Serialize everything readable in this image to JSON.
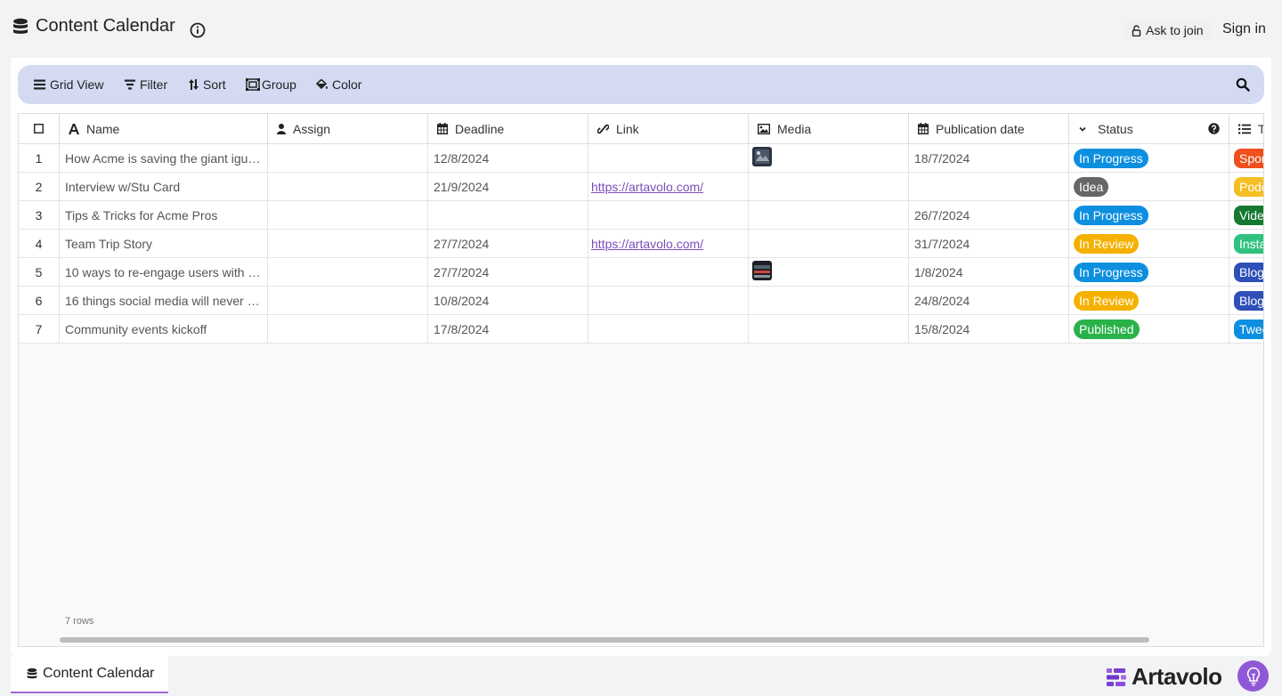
{
  "header": {
    "title": "Content Calendar",
    "ask_join": "Ask to join",
    "sign_in": "Sign in"
  },
  "toolbar": {
    "grid_view": "Grid View",
    "filter": "Filter",
    "sort": "Sort",
    "group": "Group",
    "color": "Color"
  },
  "columns": [
    {
      "label": "Name",
      "icon": "text-icon"
    },
    {
      "label": "Assign",
      "icon": "user-icon"
    },
    {
      "label": "Deadline",
      "icon": "calendar-icon"
    },
    {
      "label": "Link",
      "icon": "link-icon"
    },
    {
      "label": "Media",
      "icon": "image-icon"
    },
    {
      "label": "Publication date",
      "icon": "calendar-icon"
    },
    {
      "label": "Status",
      "icon": "chevron-down-icon"
    },
    {
      "label": "Ty",
      "icon": "list-icon"
    }
  ],
  "rows": [
    {
      "num": "1",
      "name": "How Acme is saving the giant igu…",
      "assign": "",
      "deadline": "12/8/2024",
      "link": "",
      "media": "thumb",
      "pub_date": "18/7/2024",
      "status": "In Progress",
      "type": "Spon"
    },
    {
      "num": "2",
      "name": "Interview w/Stu Card",
      "assign": "",
      "deadline": "21/9/2024",
      "link": "https://artavolo.com/",
      "media": "",
      "pub_date": "",
      "status": "Idea",
      "type": "Podc"
    },
    {
      "num": "3",
      "name": "Tips & Tricks for Acme Pros",
      "assign": "",
      "deadline": "",
      "link": "",
      "media": "",
      "pub_date": "26/7/2024",
      "status": "In Progress",
      "type": "Vide"
    },
    {
      "num": "4",
      "name": "Team Trip Story",
      "assign": "",
      "deadline": "27/7/2024",
      "link": "https://artavolo.com/",
      "media": "",
      "pub_date": "31/7/2024",
      "status": "In Review",
      "type": "Insta"
    },
    {
      "num": "5",
      "name": "10 ways to re-engage users with …",
      "assign": "",
      "deadline": "27/7/2024",
      "link": "",
      "media": "thumb",
      "pub_date": "1/8/2024",
      "status": "In Progress",
      "type": "Blog"
    },
    {
      "num": "6",
      "name": "16 things social media will never …",
      "assign": "",
      "deadline": "10/8/2024",
      "link": "",
      "media": "",
      "pub_date": "24/8/2024",
      "status": "In Review",
      "type": "Blog"
    },
    {
      "num": "7",
      "name": "Community events kickoff",
      "assign": "",
      "deadline": "17/8/2024",
      "link": "",
      "media": "",
      "pub_date": "15/8/2024",
      "status": "Published",
      "type": "Twee"
    }
  ],
  "status_colors": {
    "In Progress": "#0d8fe0",
    "Idea": "#666666",
    "In Review": "#f5b100",
    "Published": "#2ab24a"
  },
  "type_colors": {
    "Spon": "#ef4f1c",
    "Podc": "#f5be22",
    "Vide": "#137a2f",
    "Insta": "#2ec27e",
    "Blog": "#2f4fb8",
    "Twee": "#0d8fe0"
  },
  "footer": {
    "row_count": "7 rows"
  },
  "bottom": {
    "tab": "Content Calendar",
    "brand": "Artavolo"
  }
}
